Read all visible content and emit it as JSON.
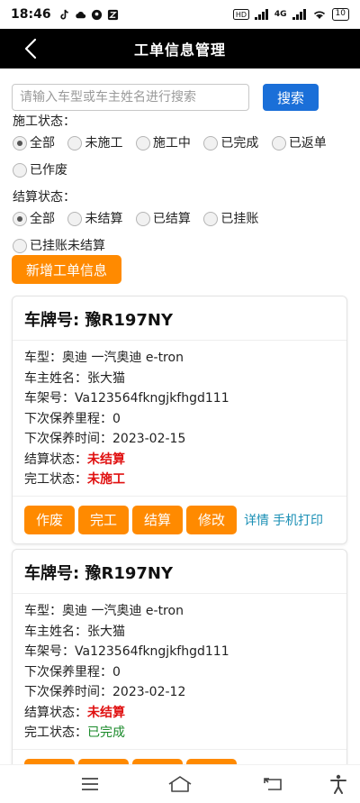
{
  "status_bar": {
    "time": "18:46",
    "network_label": "4G",
    "battery": "10",
    "icons": [
      "tiktok-icon",
      "cloud-icon",
      "pin-icon",
      "app-icon",
      "hd-icon",
      "signal-icon",
      "wifi-icon",
      "battery-icon"
    ]
  },
  "nav": {
    "title": "工单信息管理",
    "back_icon": "chevron-left-icon"
  },
  "search": {
    "placeholder": "请输入车型或车主姓名进行搜索",
    "value": "",
    "button_label": "搜索"
  },
  "construction_filter": {
    "label": "施工状态：",
    "options": [
      "全部",
      "未施工",
      "施工中",
      "已完成",
      "已返单",
      "已作废"
    ],
    "selected": "全部"
  },
  "settlement_filter": {
    "label": "结算状态：",
    "options": [
      "全部",
      "未结算",
      "已结算",
      "已挂账",
      "已挂账未结算"
    ],
    "selected": "全部"
  },
  "add_button_label": "新增工单信息",
  "labels": {
    "plate": "车牌号: ",
    "model": "车型：",
    "owner": "车主姓名：",
    "vin": "车架号：",
    "next_mileage": "下次保养里程：",
    "next_time": "下次保养时间：",
    "settle_status": "结算状态：",
    "finish_status": "完工状态："
  },
  "actions": {
    "void": "作废",
    "complete": "完工",
    "settle": "结算",
    "edit": "修改",
    "detail": "详情",
    "print": "手机打印"
  },
  "orders": [
    {
      "plate": "豫R197NY",
      "model": "奥迪 一汽奥迪 e-tron",
      "owner": "张大猫",
      "vin": "Va123564fkngjkfhgd111",
      "next_mileage": "0",
      "next_time": "2023-02-15",
      "settle_status": "未结算",
      "finish_status": "未施工"
    },
    {
      "plate": "豫R197NY",
      "model": "奥迪 一汽奥迪 e-tron",
      "owner": "张大猫",
      "vin": "Va123564fkngjkfhgd111",
      "next_mileage": "0",
      "next_time": "2023-02-12",
      "settle_status": "未结算",
      "finish_status": "已完成"
    }
  ],
  "colors": {
    "accent_orange": "#ff8a00",
    "search_blue": "#1a6fd8",
    "status_red": "#e01010",
    "status_green": "#1a8a2a",
    "link_blue": "#1a8fb5",
    "nav_black": "#000000"
  },
  "system_nav": [
    "menu-icon",
    "home-icon",
    "back-icon",
    "accessibility-icon"
  ]
}
